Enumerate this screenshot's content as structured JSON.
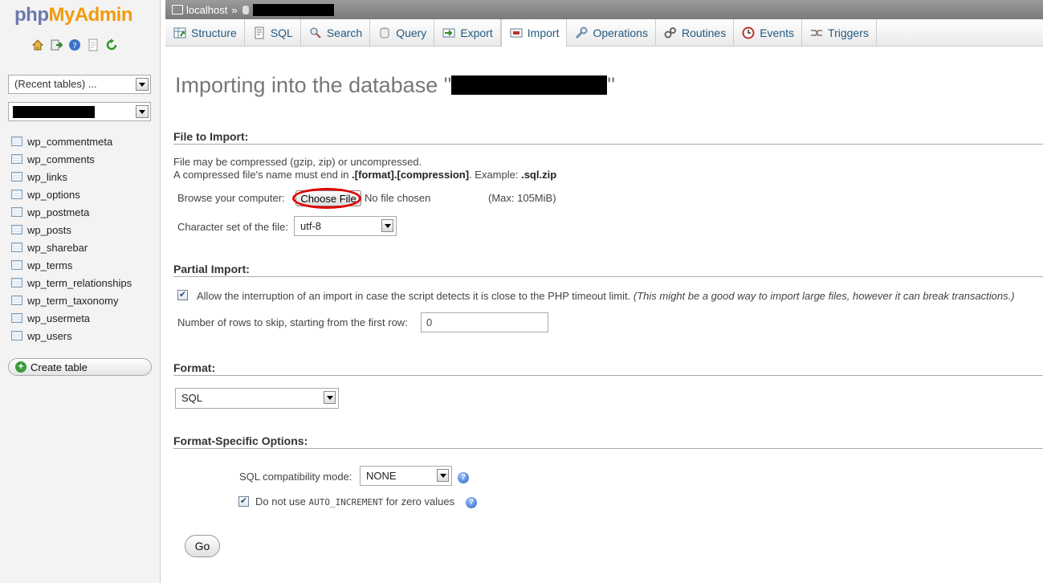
{
  "nav": {
    "logo_php": "php",
    "logo_my": "My",
    "logo_admin": "Admin",
    "recent_tables": "(Recent tables) ...",
    "tables": [
      "wp_commentmeta",
      "wp_comments",
      "wp_links",
      "wp_options",
      "wp_postmeta",
      "wp_posts",
      "wp_sharebar",
      "wp_terms",
      "wp_term_relationships",
      "wp_term_taxonomy",
      "wp_usermeta",
      "wp_users"
    ],
    "create_table": "Create table"
  },
  "topbar": {
    "server": "localhost",
    "separator": "»"
  },
  "tabs": [
    {
      "label": "Structure",
      "icon": "structure-icon"
    },
    {
      "label": "SQL",
      "icon": "sql-icon"
    },
    {
      "label": "Search",
      "icon": "search-icon"
    },
    {
      "label": "Query",
      "icon": "query-icon"
    },
    {
      "label": "Export",
      "icon": "export-icon"
    },
    {
      "label": "Import",
      "icon": "import-icon"
    },
    {
      "label": "Operations",
      "icon": "wrench-icon"
    },
    {
      "label": "Routines",
      "icon": "routines-icon"
    },
    {
      "label": "Events",
      "icon": "clock-icon"
    },
    {
      "label": "Triggers",
      "icon": "triggers-icon"
    }
  ],
  "main": {
    "title_prefix": "Importing into the database \"",
    "title_suffix": "\"",
    "file_section": {
      "title": "File to Import:",
      "line1": "File may be compressed (gzip, zip) or uncompressed.",
      "line2_prefix": "A compressed file's name must end in ",
      "line2_bold": ".[format].[compression]",
      "line2_mid": ". Example: ",
      "line2_example": ".sql.zip",
      "browse_label": "Browse your computer:",
      "choose_file": "Choose File",
      "no_file": "No file chosen",
      "max_size": "(Max: 105MiB)",
      "charset_label": "Character set of the file:",
      "charset_value": "utf-8"
    },
    "partial_section": {
      "title": "Partial Import:",
      "allow_interrupt": "Allow the interruption of an import in case the script detects it is close to the PHP timeout limit.",
      "allow_interrupt_note": "(This might be a good way to import large files, however it can break transactions.)",
      "allow_interrupt_checked": true,
      "skip_label": "Number of rows to skip, starting from the first row:",
      "skip_value": "0"
    },
    "format_section": {
      "title": "Format:",
      "format_value": "SQL"
    },
    "options_section": {
      "title": "Format-Specific Options:",
      "compat_label": "SQL compatibility mode:",
      "compat_value": "NONE",
      "auto_inc_prefix": "Do not use ",
      "auto_inc_code": "AUTO_INCREMENT",
      "auto_inc_suffix": " for zero values",
      "auto_inc_checked": true
    },
    "go_button": "Go"
  },
  "colors": {
    "tab_text": "#235a81",
    "title_gray": "#777777",
    "highlight_red": "#e00000",
    "logo_blue": "#6c78af",
    "logo_orange": "#f29b0b"
  }
}
